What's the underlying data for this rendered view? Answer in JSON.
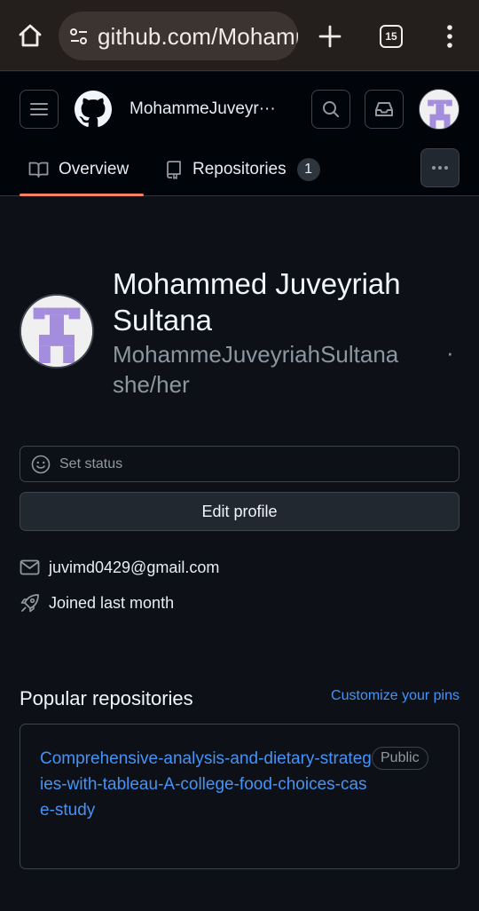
{
  "browser": {
    "url": "github.com/MohammeJuveyriahSultana",
    "tab_count": "15"
  },
  "header": {
    "username": "MohammeJuveyr···"
  },
  "tabs": [
    {
      "label": "Overview",
      "icon": "book-icon",
      "active": true
    },
    {
      "label": "Repositories",
      "icon": "repo-icon",
      "count": "1"
    }
  ],
  "profile": {
    "full_name": "Mohammed Juveyriah Sultana",
    "login": "MohammeJuveyriahSultana",
    "separator": "·",
    "pronouns": "she/her",
    "status_placeholder": "Set status",
    "edit_label": "Edit profile",
    "email": "juvimd0429@gmail.com",
    "joined": "Joined last month"
  },
  "popular": {
    "title": "Popular repositories",
    "customize_label": "Customize your pins",
    "repos": [
      {
        "name": "Comprehensive-analysis-and-dietary-strategies-with-tableau-A-college-food-choices-case-study",
        "visibility": "Public"
      }
    ]
  },
  "colors": {
    "accent_link": "#4493f8",
    "tab_underline": "#f78166",
    "identicon": "#a48ddc"
  }
}
